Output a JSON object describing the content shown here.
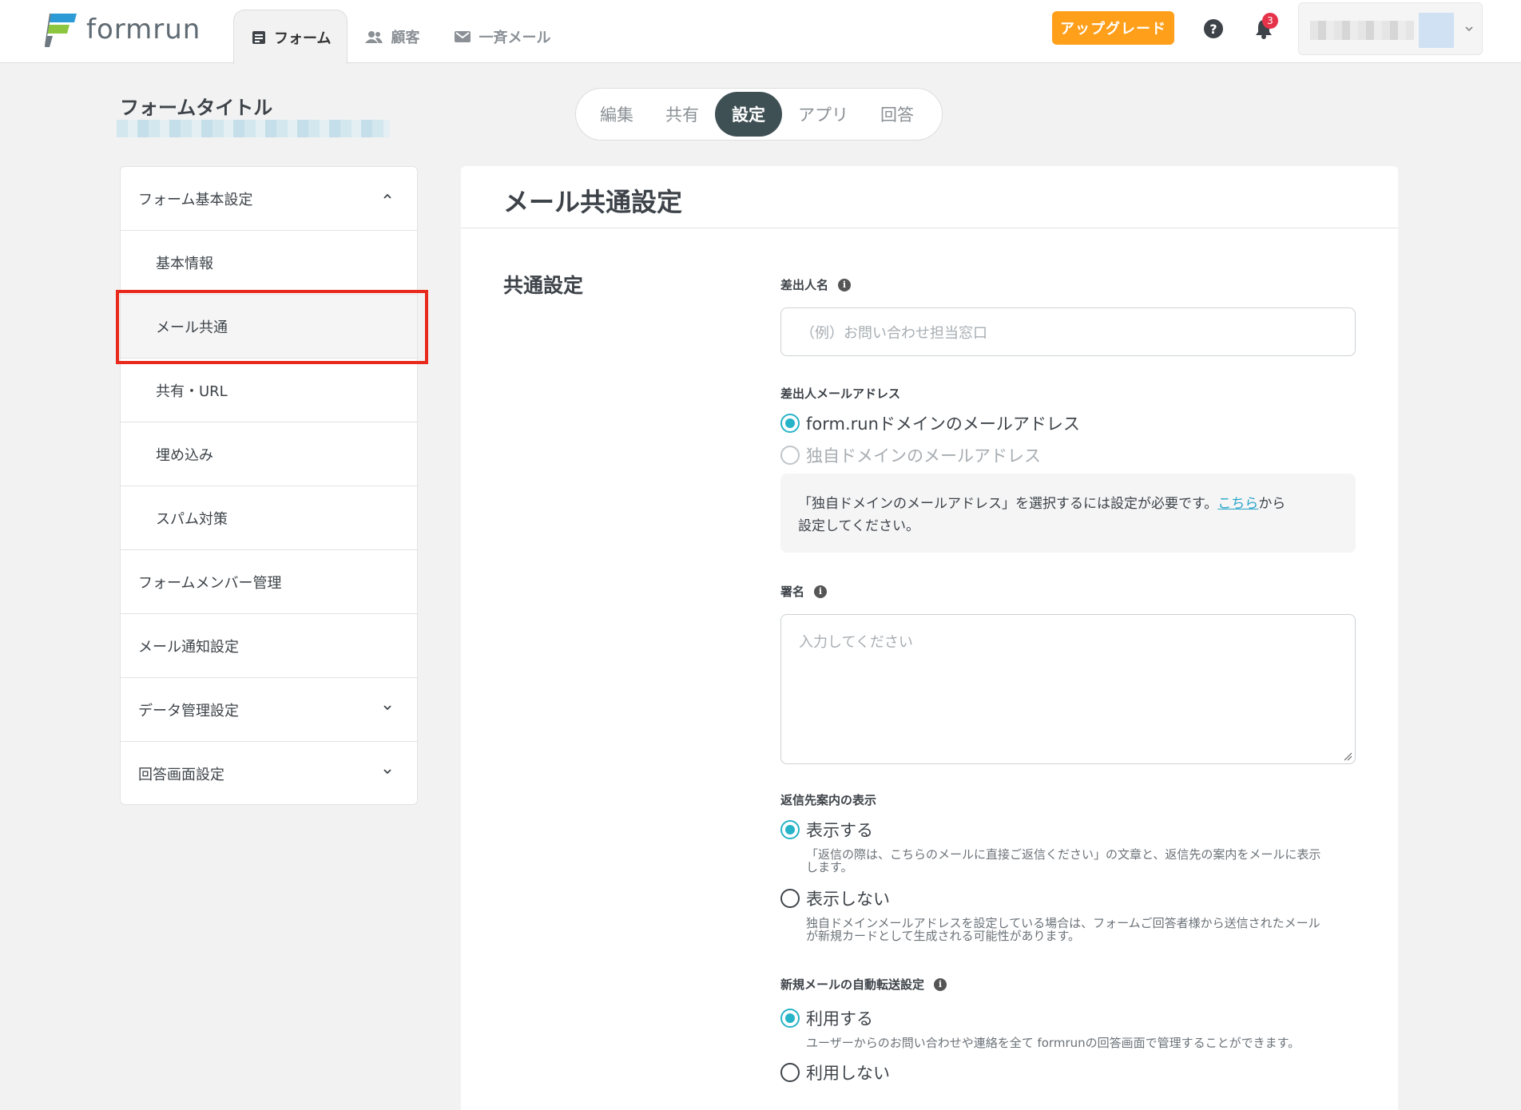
{
  "header": {
    "logo_text": "formrun",
    "tabs": [
      {
        "label": "フォーム",
        "icon": "form-icon",
        "active": true
      },
      {
        "label": "顧客",
        "icon": "people-icon",
        "active": false
      },
      {
        "label": "一斉メール",
        "icon": "mail-icon",
        "active": false
      }
    ],
    "upgrade_label": "アップグレード",
    "help_glyph": "?",
    "notification_count": "3"
  },
  "form": {
    "title": "フォームタイトル"
  },
  "segments": {
    "items": [
      "編集",
      "共有",
      "設定",
      "アプリ",
      "回答"
    ],
    "active": "設定"
  },
  "sidebar": {
    "items": [
      {
        "label": "フォーム基本設定",
        "chevron": "up"
      },
      {
        "label": "基本情報"
      },
      {
        "label": "メール共通",
        "selected": true
      },
      {
        "label": "共有・URL"
      },
      {
        "label": "埋め込み"
      },
      {
        "label": "スパム対策"
      },
      {
        "label": "フォームメンバー管理"
      },
      {
        "label": "メール通知設定"
      },
      {
        "label": "データ管理設定",
        "chevron": "down"
      },
      {
        "label": "回答画面設定",
        "chevron": "down"
      }
    ]
  },
  "main": {
    "title": "メール共通設定",
    "section_title": "共通設定",
    "sender_name": {
      "label": "差出人名",
      "placeholder": "（例）お問い合わせ担当窓口"
    },
    "sender_address": {
      "label": "差出人メールアドレス",
      "option_formrun": "form.runドメインのメールアドレス",
      "option_custom": "独自ドメインのメールアドレス",
      "note_before": "「独自ドメインのメールアドレス」を選択するには設定が必要です。",
      "note_link": "こちら",
      "note_after_line1": "から",
      "note_line2": "設定してください。"
    },
    "signature": {
      "label": "署名",
      "placeholder": "入力してください"
    },
    "reply_guide": {
      "label": "返信先案内の表示",
      "option_show": "表示する",
      "option_show_desc_line1": "「返信の際は、こちらのメールに直接ご返信ください」の文章と、返信先の案内をメールに表示",
      "option_show_desc_line2": "します。",
      "option_hide": "表示しない",
      "option_hide_desc_line1": "独自ドメインメールアドレスを設定している場合は、フォームご回答者様から送信されたメール",
      "option_hide_desc_line2": "が新規カードとして生成される可能性があります。"
    },
    "auto_forward": {
      "label": "新規メールの自動転送設定",
      "option_use": "利用する",
      "option_use_desc": "ユーザーからのお問い合わせや連絡を全て formrunの回答画面で管理することができます。",
      "option_nouse": "利用しない"
    }
  },
  "colors": {
    "accent": "#27b3c8",
    "upgrade": "#ff9f1a",
    "segment_active": "#3f5055",
    "highlight": "#e8291c",
    "badge": "#e5344a"
  }
}
